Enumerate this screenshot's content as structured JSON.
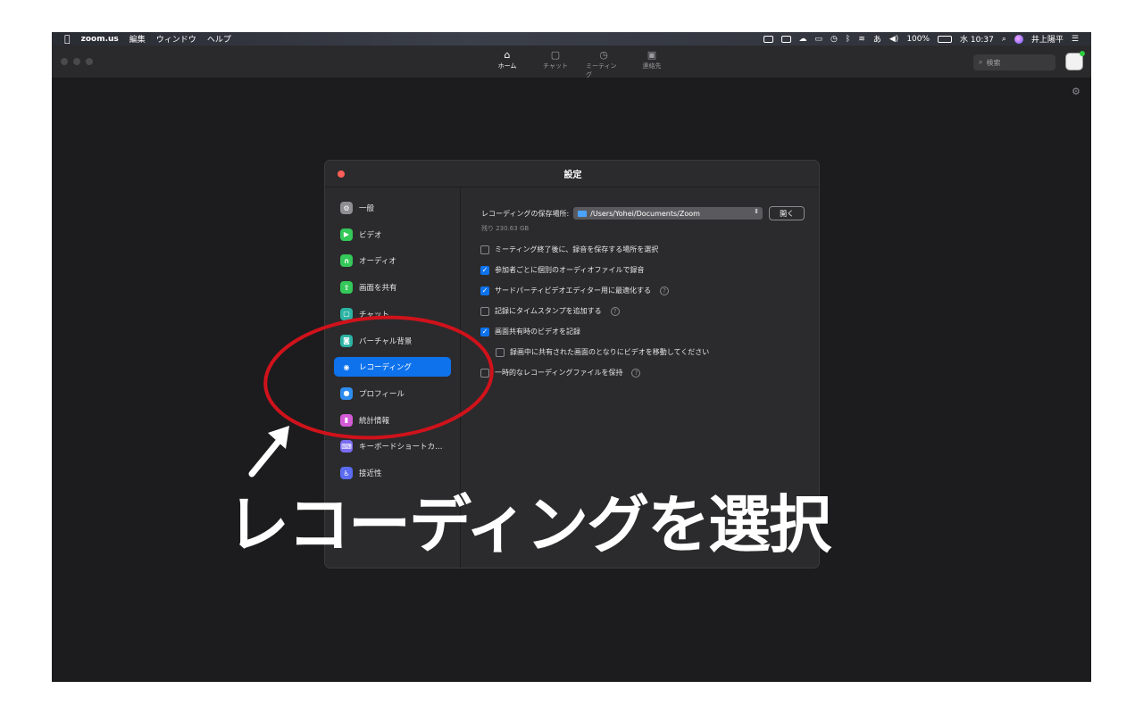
{
  "menubar": {
    "app_name": "zoom.us",
    "menus": [
      "編集",
      "ウィンドウ",
      "ヘルプ"
    ],
    "battery": "100%",
    "clock": "水 10:37",
    "user": "井上陽平",
    "input_method": "あ"
  },
  "titlebar": {
    "tabs": [
      {
        "label": "ホーム",
        "icon": "home-icon"
      },
      {
        "label": "チャット",
        "icon": "chat-icon"
      },
      {
        "label": "ミーティング",
        "icon": "clock-icon"
      },
      {
        "label": "連絡先",
        "icon": "contacts-icon"
      }
    ],
    "search_placeholder": "検索"
  },
  "dialog": {
    "title": "設定",
    "sidebar": [
      {
        "label": "一般",
        "icon": "gear-icon",
        "color": "#8e8e93"
      },
      {
        "label": "ビデオ",
        "icon": "video-icon",
        "color": "#34c759"
      },
      {
        "label": "オーディオ",
        "icon": "headphones-icon",
        "color": "#34c759"
      },
      {
        "label": "画面を共有",
        "icon": "share-screen-icon",
        "color": "#34c759"
      },
      {
        "label": "チャット",
        "icon": "chat-icon",
        "color": "#2bb3a3"
      },
      {
        "label": "バーチャル背景",
        "icon": "virtual-background-icon",
        "color": "#2bb3a3"
      },
      {
        "label": "レコーディング",
        "icon": "record-icon",
        "color": "#0e72ed"
      },
      {
        "label": "プロフィール",
        "icon": "profile-icon",
        "color": "#2e8cf0"
      },
      {
        "label": "統計情報",
        "icon": "statistics-icon",
        "color": "#d45bd6"
      },
      {
        "label": "キーボードショートカ…",
        "icon": "keyboard-icon",
        "color": "#7a6cf0"
      },
      {
        "label": "接近性",
        "icon": "accessibility-icon",
        "color": "#5b6cf0"
      }
    ],
    "active_index": 6,
    "recording": {
      "location_label": "レコーディングの保存場所:",
      "location_value": "/Users/Yohei/Documents/Zoom",
      "open_button": "開く",
      "remaining": "残り 230.63 GB",
      "options": [
        {
          "label": "ミーティング終了後に、録音を保存する場所を選択",
          "checked": false,
          "help": false,
          "indent": false
        },
        {
          "label": "参加者ごとに個別のオーディオファイルで録音",
          "checked": true,
          "help": false,
          "indent": false
        },
        {
          "label": "サードパーティビデオエディター用に最適化する",
          "checked": true,
          "help": true,
          "indent": false
        },
        {
          "label": "記録にタイムスタンプを追加する",
          "checked": false,
          "help": true,
          "indent": false
        },
        {
          "label": "画面共有時のビデオを記録",
          "checked": true,
          "help": false,
          "indent": false
        },
        {
          "label": "録画中に共有された画面のとなりにビデオを移動してください",
          "checked": false,
          "help": false,
          "indent": true
        },
        {
          "label": "一時的なレコーディングファイルを保持",
          "checked": false,
          "help": true,
          "indent": false
        }
      ]
    }
  },
  "annotation": {
    "caption": "レコーディングを選択",
    "color": "#d0121b"
  }
}
